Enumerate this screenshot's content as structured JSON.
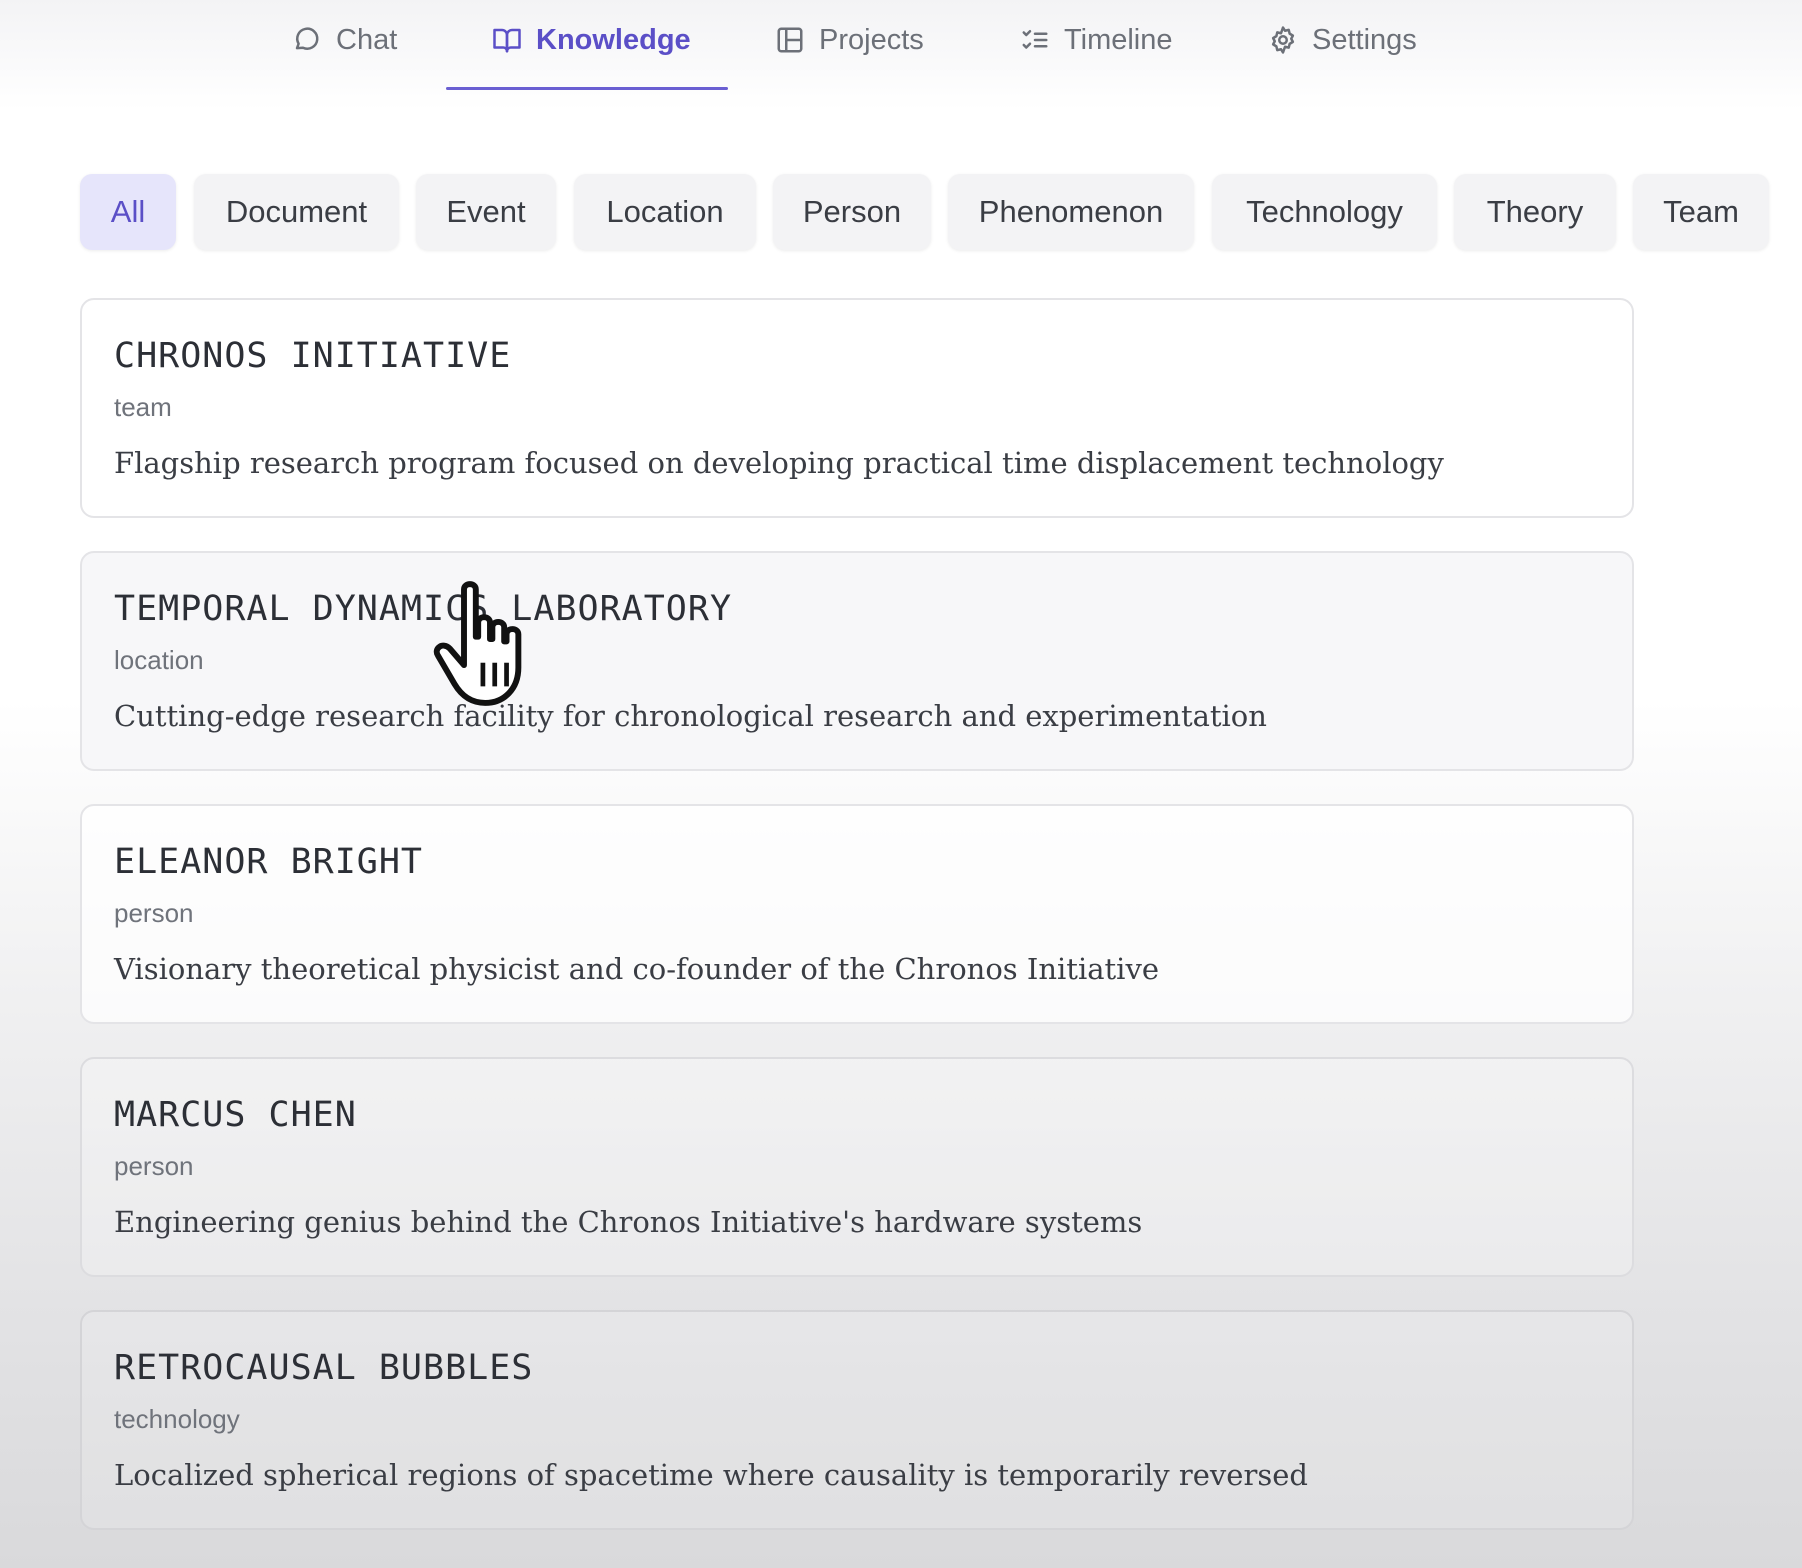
{
  "nav": {
    "tabs": [
      {
        "label": "Chat",
        "icon": "chat-bubble-icon"
      },
      {
        "label": "Knowledge",
        "icon": "book-open-icon",
        "active": true
      },
      {
        "label": "Projects",
        "icon": "layout-panel-icon"
      },
      {
        "label": "Timeline",
        "icon": "list-checks-icon"
      },
      {
        "label": "Settings",
        "icon": "gear-icon"
      }
    ]
  },
  "filters": {
    "selected": "All",
    "items": [
      "All",
      "Document",
      "Event",
      "Location",
      "Person",
      "Phenomenon",
      "Technology",
      "Theory",
      "Team"
    ]
  },
  "entities": [
    {
      "title": "CHRONOS INITIATIVE",
      "type": "team",
      "description": "Flagship research program focused on developing practical time displacement technology"
    },
    {
      "title": "TEMPORAL DYNAMICS LABORATORY",
      "type": "location",
      "description": "Cutting-edge research facility for chronological research and experimentation"
    },
    {
      "title": "ELEANOR BRIGHT",
      "type": "person",
      "description": "Visionary theoretical physicist and co-founder of the Chronos Initiative"
    },
    {
      "title": "MARCUS CHEN",
      "type": "person",
      "description": "Engineering genius behind the Chronos Initiative's hardware systems"
    },
    {
      "title": "RETROCAUSAL BUBBLES",
      "type": "technology",
      "description": "Localized spherical regions of spacetime where causality is temporarily reversed"
    }
  ],
  "colors": {
    "accent": "#5b4fc7",
    "chip_active_bg": "#e6e5fb",
    "chip_bg": "#f3f3f5"
  }
}
